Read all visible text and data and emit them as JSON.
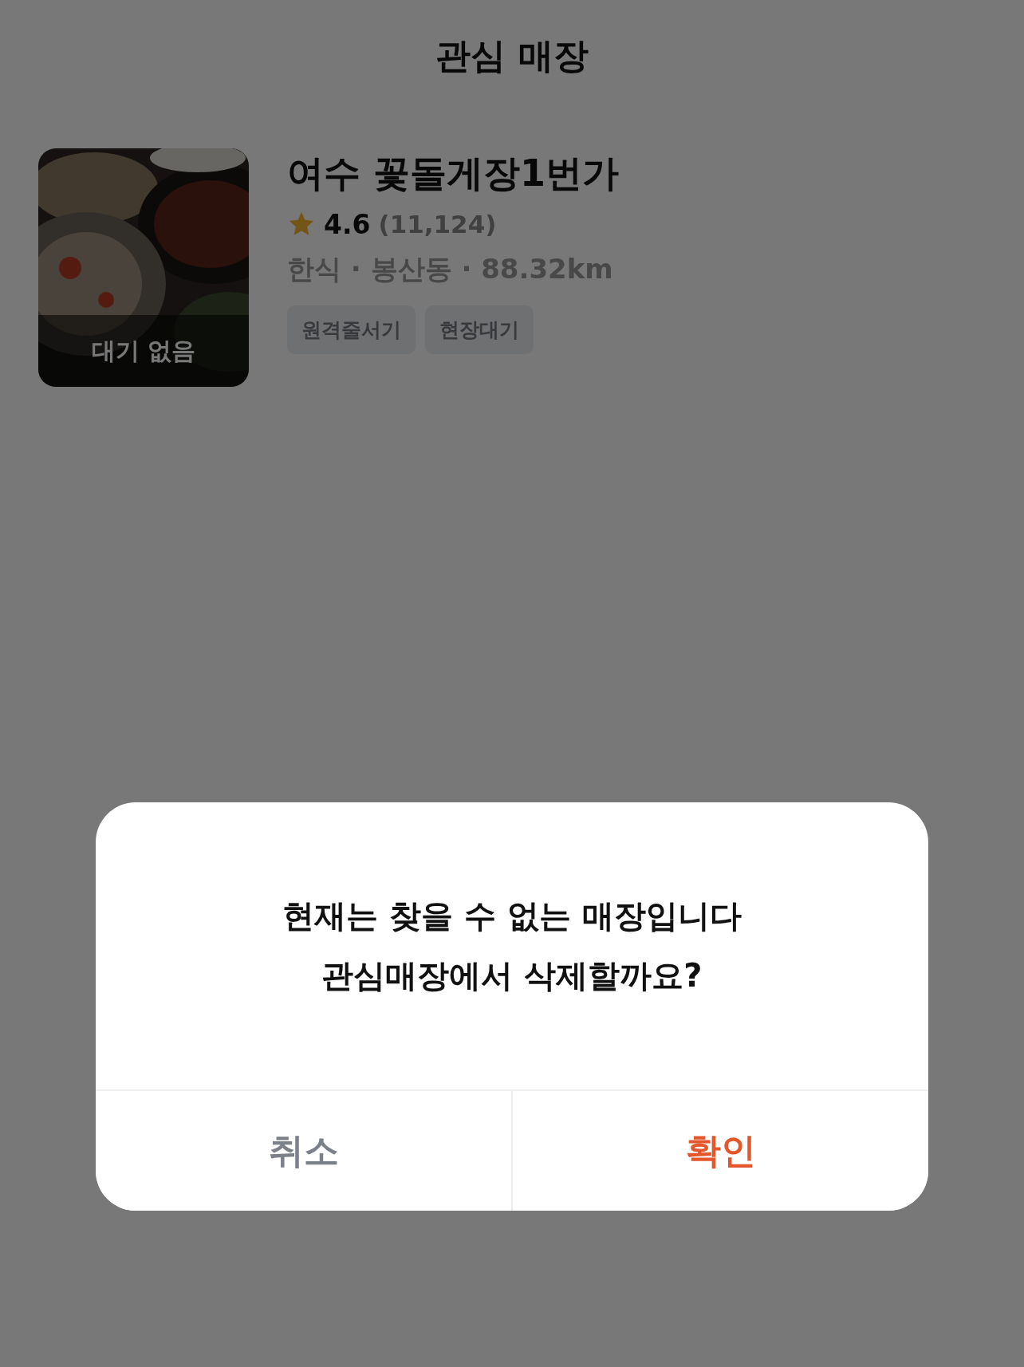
{
  "screen_title": "관심 매장",
  "stores": [
    {
      "name": "여수 꽃돌게장1번가",
      "rating": "4.6",
      "review_count": "(11,124)",
      "meta": "한식 · 봉산동 · 88.32km",
      "wait_status": "대기 없음",
      "tags": [
        "원격줄서기",
        "현장대기"
      ]
    }
  ],
  "dialog": {
    "message_lines": [
      "현재는 찾을 수 없는 매장입니다",
      "관심매장에서 삭제할까요?"
    ],
    "buttons": [
      {
        "label": "취소",
        "kind": "cancel"
      },
      {
        "label": "확인",
        "kind": "confirm"
      }
    ]
  }
}
